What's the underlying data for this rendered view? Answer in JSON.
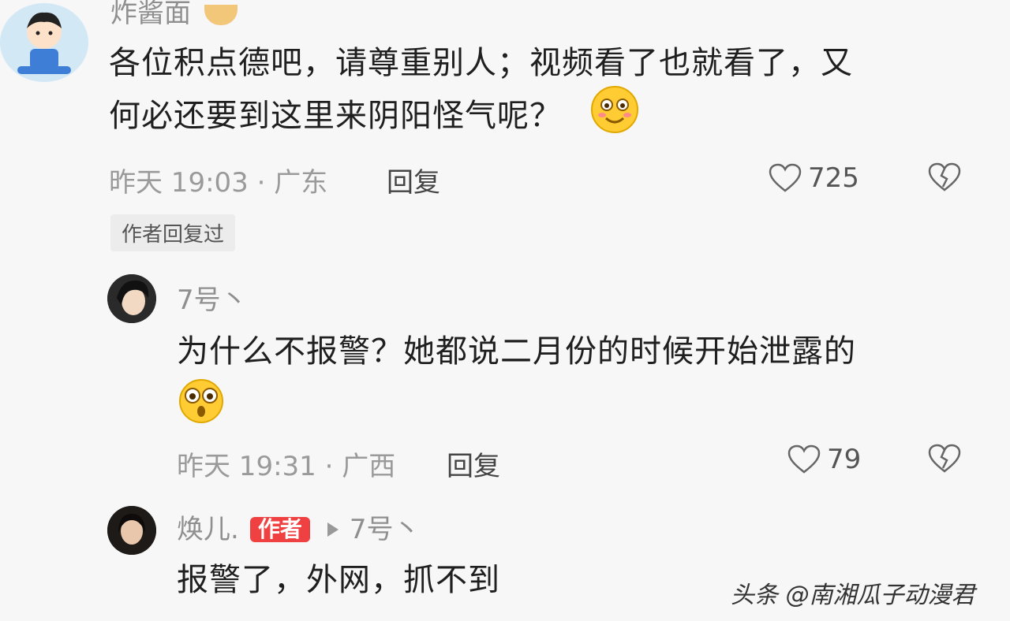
{
  "comment1": {
    "username": "炸酱面",
    "text_line1": "各位积点德吧，请尊重别人；视频看了也就看了，又",
    "text_line2": "何必还要到这里来阴阳怪气呢？",
    "time_location": "昨天 19:03 · 广东",
    "reply_label": "回复",
    "like_count": "725",
    "author_replied_tag": "作者回复过"
  },
  "reply1": {
    "username": "7号丶",
    "text_line1": "为什么不报警？她都说二月份的时候开始泄露的",
    "time_location": "昨天 19:31 · 广西",
    "reply_label": "回复",
    "like_count": "79"
  },
  "reply2": {
    "username": "焕儿.",
    "author_badge": "作者",
    "reply_to": "7号丶",
    "text": "报警了，外网，抓不到"
  },
  "watermark": "头条 @南湘瓜子动漫君",
  "colors": {
    "author_badge": "#f04142",
    "background": "#f7f7f7"
  }
}
